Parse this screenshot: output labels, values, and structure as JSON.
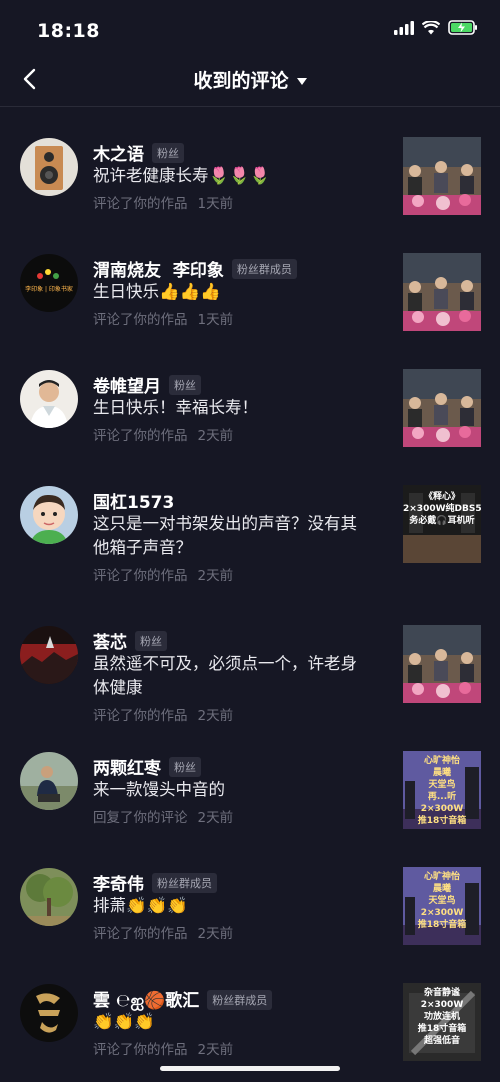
{
  "status": {
    "time": "18:18"
  },
  "nav": {
    "title": "收到的评论"
  },
  "comments": [
    {
      "name": "木之语",
      "badge": "粉丝",
      "text": "祝许老健康长寿🌷🌷🌷",
      "action": "评论了你的作品",
      "time": "1天前"
    },
    {
      "name": "渭南烧友  李印象",
      "badge": "粉丝群成员",
      "text": "生日快乐👍👍👍",
      "action": "评论了你的作品",
      "time": "1天前"
    },
    {
      "name": "卷帷望月",
      "badge": "粉丝",
      "text": "生日快乐！幸福长寿！",
      "action": "评论了你的作品",
      "time": "2天前"
    },
    {
      "name": "国杠1573",
      "badge": "",
      "text": "这只是一对书架发出的声音？没有其他箱子声音？",
      "action": "评论了你的作品",
      "time": "2天前"
    },
    {
      "name": "荟芯",
      "badge": "粉丝",
      "text": "虽然遥不可及，必须点一个，许老身体健康",
      "action": "评论了你的作品",
      "time": "2天前"
    },
    {
      "name": "两颗红枣",
      "badge": "粉丝",
      "text": "来一款馒头中音的",
      "action": "回复了你的评论",
      "time": "2天前"
    },
    {
      "name": "李奇伟",
      "badge": "粉丝群成员",
      "text": "排萧👏👏👏",
      "action": "评论了你的作品",
      "time": "2天前"
    },
    {
      "name": "雲 ℮ஐ🏀歌汇",
      "badge": "粉丝群成员",
      "text": "👏👏👏",
      "action": "评论了你的作品",
      "time": "2天前"
    }
  ],
  "thumb_text": {
    "t4": "《释心》\n2×300W纯DBS5\n务必戴🎧耳机听",
    "t6": "心旷神怡\n晨曦\n天堂鸟\n再...听\n2×300W\n推18寸音箱",
    "t8": "心旷神怡\n晨曦\n天堂鸟\n2×300W\n推18寸音箱",
    "t9": "杂音静谧\n2×300W\n功放连机\n推18寸音箱\n超强低音"
  },
  "avatar_text": {
    "a2": "李印象 | 印象书家"
  }
}
